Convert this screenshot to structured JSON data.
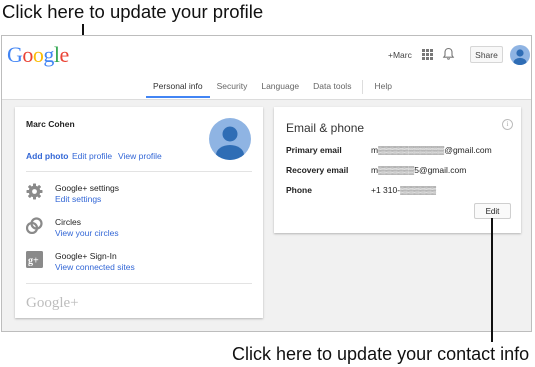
{
  "callouts": {
    "top": "Click here to update your profile",
    "bottom": "Click here to update your contact info"
  },
  "header": {
    "logo_letters": [
      "G",
      "o",
      "o",
      "g",
      "l",
      "e"
    ],
    "plus_link": "+Marc",
    "share_label": "Share",
    "icons": [
      "apps-grid-icon",
      "bell-icon",
      "user-avatar"
    ]
  },
  "tabs": [
    {
      "label": "Personal info",
      "active": true
    },
    {
      "label": "Security",
      "active": false
    },
    {
      "label": "Language",
      "active": false
    },
    {
      "label": "Data tools",
      "active": false
    },
    {
      "label": "Help",
      "active": false
    }
  ],
  "profile": {
    "name": "Marc Cohen",
    "add_photo": "Add photo",
    "edit_profile": "Edit profile",
    "view_profile": "View profile",
    "services": [
      {
        "title": "Google+ settings",
        "link": "Edit settings",
        "icon": "gear-icon"
      },
      {
        "title": "Circles",
        "link": "View your circles",
        "icon": "circles-icon"
      },
      {
        "title": "Google+ Sign-In",
        "link": "View connected sites",
        "icon": "google-plus-icon"
      }
    ],
    "footer_logo": "Google+"
  },
  "contact": {
    "title": "Email & phone",
    "rows": [
      {
        "label": "Primary email",
        "value": "m▒▒▒▒▒▒▒▒▒▒▒@gmail.com"
      },
      {
        "label": "Recovery email",
        "value": "m▒▒▒▒▒▒5@gmail.com"
      },
      {
        "label": "Phone",
        "value": "+1 310-▒▒▒▒▒▒"
      }
    ],
    "edit_label": "Edit"
  },
  "colors": {
    "link_blue": "#3367d6",
    "tab_underline": "#4285f4",
    "avatar_blue": "#8fb4e3",
    "avatar_dark": "#2f6db5"
  }
}
